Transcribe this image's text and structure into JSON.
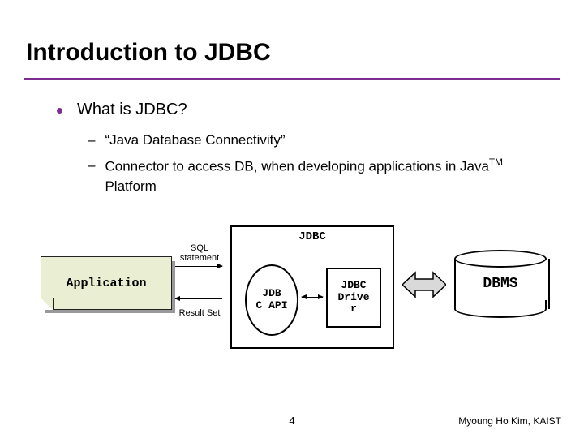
{
  "title": "Introduction to JDBC",
  "bullet1": "What is JDBC?",
  "sub1": "“Java Database Connectivity”",
  "sub2_a": "Connector to access DB, when developing applications in Java",
  "sub2_tm": "TM",
  "sub2_b": " Platform",
  "diagram": {
    "application": "Application",
    "sql_label_1": "SQL",
    "sql_label_2": "statement",
    "result_label": "Result Set",
    "jdbc_title": "JDBC",
    "api": "JDB\nC API",
    "driver": "JDBC Drive\nr",
    "dbms": "DBMS"
  },
  "page": "4",
  "author": "Myoung Ho Kim, KAIST"
}
